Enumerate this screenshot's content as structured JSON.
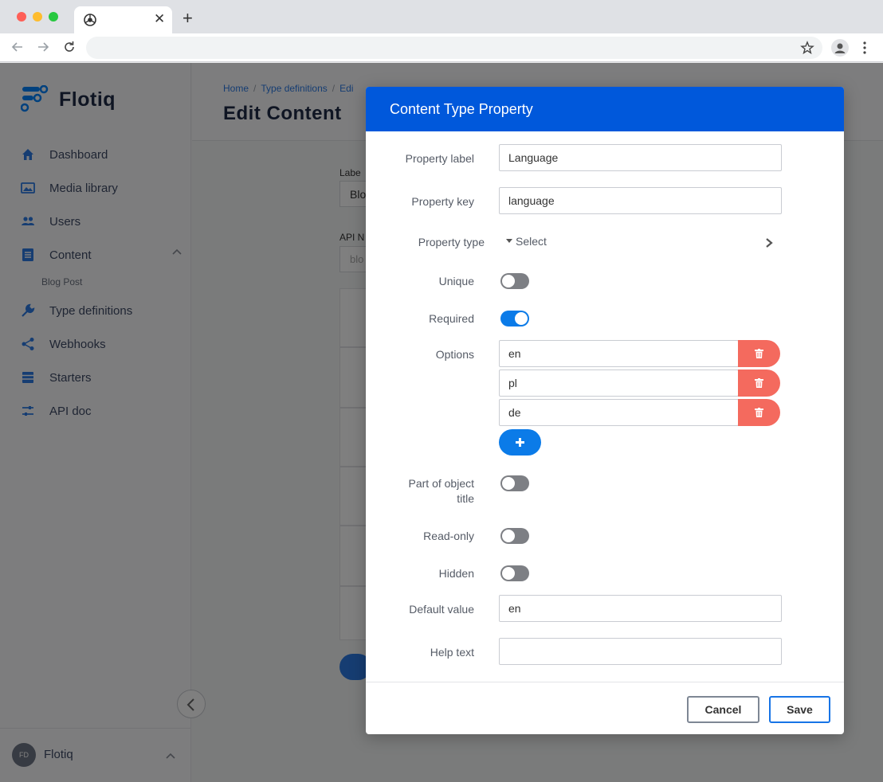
{
  "browser": {
    "tab_close": "✕",
    "new_tab": "+"
  },
  "sidebar": {
    "logo_text": "Flotiq",
    "items": [
      {
        "label": "Dashboard",
        "icon": "home-icon"
      },
      {
        "label": "Media library",
        "icon": "image-icon"
      },
      {
        "label": "Users",
        "icon": "users-icon"
      },
      {
        "label": "Content",
        "icon": "document-icon"
      },
      {
        "label": "Type definitions",
        "icon": "wrench-icon"
      },
      {
        "label": "Webhooks",
        "icon": "share-icon"
      },
      {
        "label": "Starters",
        "icon": "list-icon"
      },
      {
        "label": "API doc",
        "icon": "sliders-icon"
      }
    ],
    "sub_item": "Blog Post",
    "user": {
      "initials": "FD",
      "name": "Flotiq"
    }
  },
  "header": {
    "breadcrumb": [
      "Home",
      "Type definitions",
      "Edi"
    ],
    "title": "Edit Content"
  },
  "background_form": {
    "label_label": "Labe",
    "label_value": "Blo",
    "api_label": "API N",
    "api_placeholder": "blo"
  },
  "modal": {
    "title": "Content Type Property",
    "fields": {
      "property_label": {
        "label": "Property label",
        "value": "Language"
      },
      "property_key": {
        "label": "Property key",
        "value": "language"
      },
      "property_type": {
        "label": "Property type",
        "value": "Select"
      },
      "unique": {
        "label": "Unique",
        "on": false
      },
      "required": {
        "label": "Required",
        "on": true
      },
      "options": {
        "label": "Options",
        "values": [
          "en",
          "pl",
          "de"
        ]
      },
      "part_of_title": {
        "label_line1": "Part of object",
        "label_line2": "title",
        "on": false
      },
      "read_only": {
        "label": "Read-only",
        "on": false
      },
      "hidden": {
        "label": "Hidden",
        "on": false
      },
      "default_value": {
        "label": "Default value",
        "value": "en"
      },
      "help_text": {
        "label": "Help text",
        "value": ""
      }
    },
    "buttons": {
      "cancel": "Cancel",
      "save": "Save"
    }
  },
  "colors": {
    "modal_header": "#0058db",
    "toggle_on": "#0b7be8",
    "delete_button": "#f46a5e",
    "add_button": "#0b7be8"
  }
}
